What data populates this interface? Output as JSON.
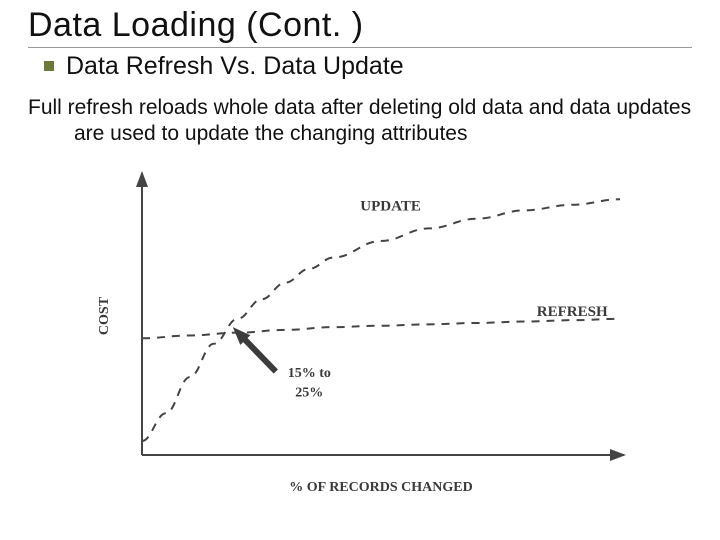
{
  "title": "Data Loading (Cont. )",
  "subtitle": "Data Refresh Vs. Data Update",
  "body": "Full refresh reloads whole data after deleting old data and data updates are used to update the changing attributes",
  "chart_data": {
    "type": "line",
    "title": "",
    "xlabel": "% OF RECORDS CHANGED",
    "ylabel": "COST",
    "xlim": [
      0,
      100
    ],
    "ylim": [
      0,
      100
    ],
    "annotations": [
      {
        "text": "UPDATE",
        "x": 52,
        "y": 88
      },
      {
        "text": "REFRESH",
        "x": 90,
        "y": 50
      },
      {
        "text": "15% to",
        "x": 35,
        "y": 28
      },
      {
        "text": "25%",
        "x": 35,
        "y": 21
      }
    ],
    "arrow": {
      "from_x": 28,
      "from_y": 30,
      "to_x": 19,
      "to_y": 46
    },
    "series": [
      {
        "name": "REFRESH",
        "x": [
          0,
          10,
          20,
          30,
          40,
          50,
          60,
          70,
          80,
          90,
          100
        ],
        "values": [
          42,
          43,
          44,
          45,
          46,
          46.5,
          47,
          47.5,
          48,
          48.5,
          49
        ]
      },
      {
        "name": "UPDATE",
        "x": [
          0,
          5,
          10,
          15,
          20,
          25,
          30,
          35,
          40,
          50,
          60,
          70,
          80,
          90,
          100
        ],
        "values": [
          5,
          15,
          28,
          40,
          49,
          56,
          62,
          67,
          71,
          77,
          81.5,
          85,
          88,
          90,
          92
        ]
      }
    ],
    "intersection_note": "Curves cross roughly between 15% and 25% of records changed"
  }
}
